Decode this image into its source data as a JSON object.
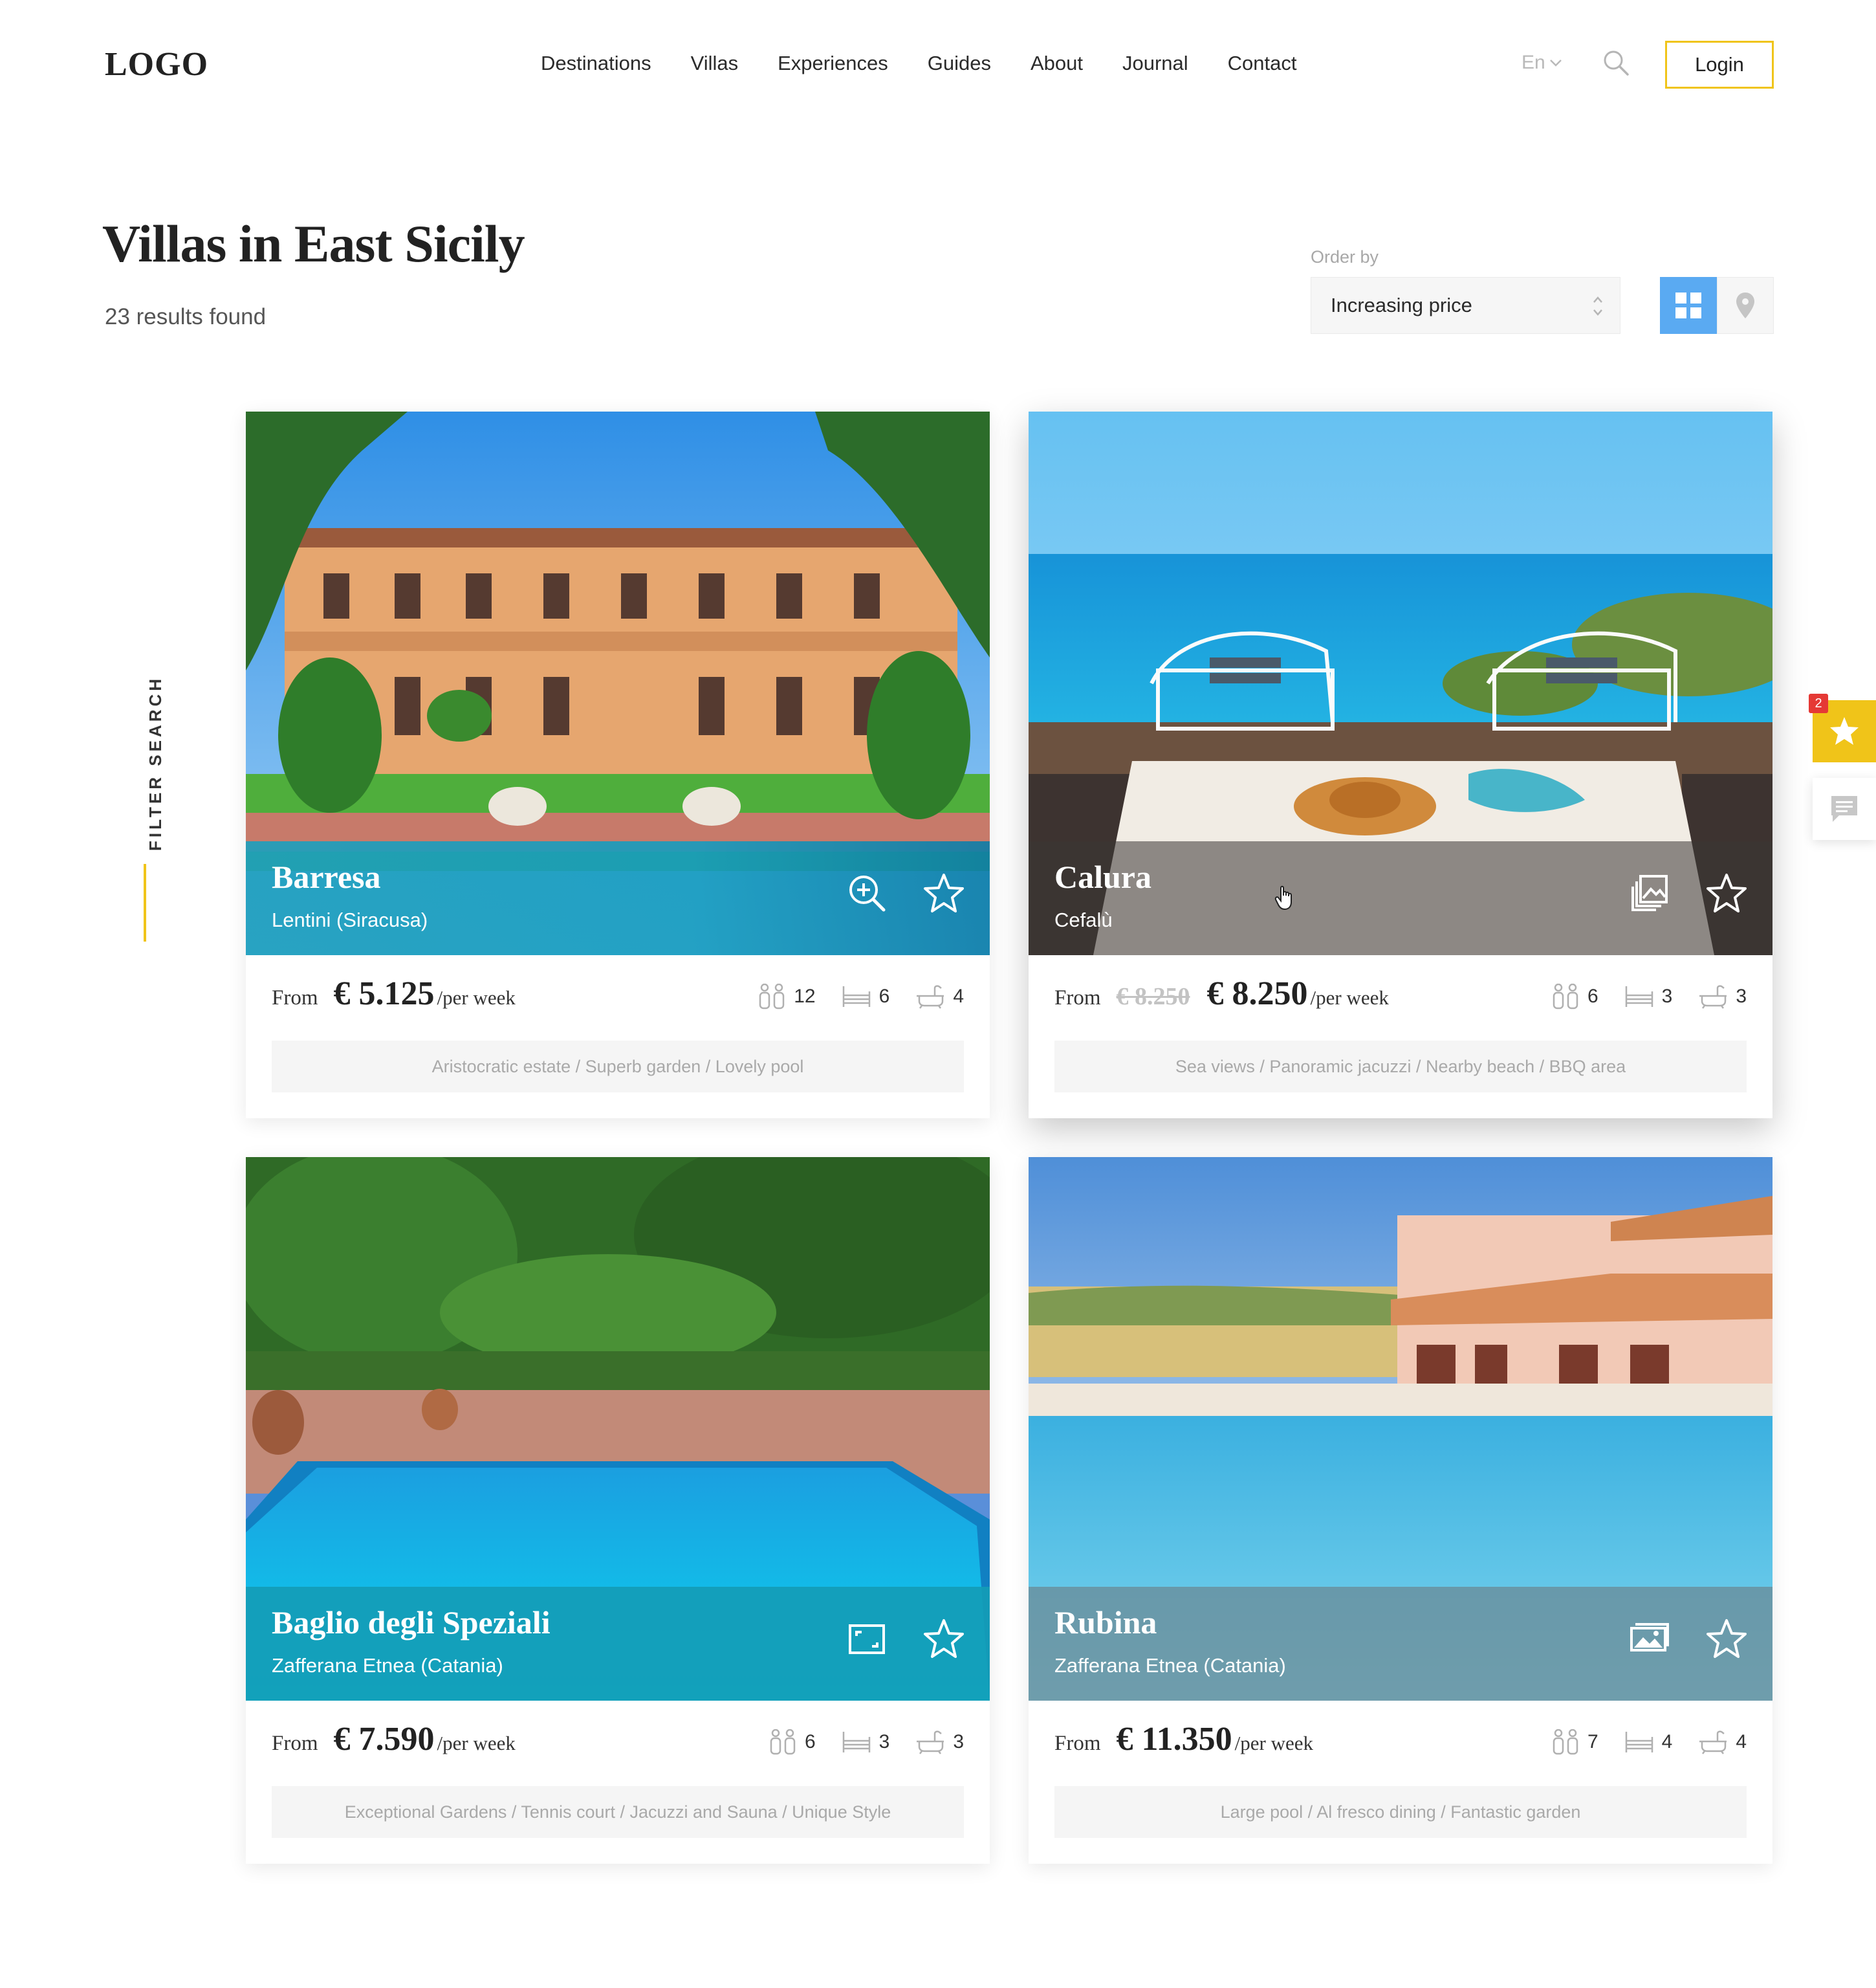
{
  "header": {
    "logo": "LOGO",
    "nav": [
      "Destinations",
      "Villas",
      "Experiences",
      "Guides",
      "About",
      "Journal",
      "Contact"
    ],
    "language": "En",
    "login_label": "Login"
  },
  "page": {
    "title": "Villas in East Sicily",
    "results": "23 results found",
    "order_label": "Order by",
    "order_value": "Increasing price",
    "filter_label": "FILTER SEARCH",
    "favorites_count": "2"
  },
  "villas": [
    {
      "name": "Barresa",
      "location": "Lentini (Siracusa)",
      "from_label": "From",
      "old_price": "",
      "price": "€ 5.125",
      "per": "/per week",
      "guests": "12",
      "bedrooms": "6",
      "bathrooms": "4",
      "tags": "Aristocratic estate / Superb garden / Lovely pool",
      "action_icon": "zoom-in-icon"
    },
    {
      "name": "Calura",
      "location": "Cefalù",
      "from_label": "From",
      "old_price": "€ 8.250",
      "price": "€ 8.250",
      "per": "/per week",
      "guests": "6",
      "bedrooms": "3",
      "bathrooms": "3",
      "tags": "Sea views / Panoramic jacuzzi / Nearby beach / BBQ area",
      "action_icon": "gallery-icon"
    },
    {
      "name": "Baglio degli Speziali",
      "location": "Zafferana Etnea (Catania)",
      "from_label": "From",
      "old_price": "",
      "price": "€ 7.590",
      "per": "/per week",
      "guests": "6",
      "bedrooms": "3",
      "bathrooms": "3",
      "tags": "Exceptional Gardens / Tennis court / Jacuzzi and Sauna / Unique Style",
      "action_icon": "fullscreen-icon"
    },
    {
      "name": "Rubina",
      "location": "Zafferana Etnea (Catania)",
      "from_label": "From",
      "old_price": "",
      "price": "€ 11.350",
      "per": "/per week",
      "guests": "7",
      "bedrooms": "4",
      "bathrooms": "4",
      "tags": "Large pool / Al fresco dining / Fantastic garden",
      "action_icon": "image-icon"
    }
  ],
  "colors": {
    "accent": "#f0c419",
    "view_active": "#5aaaf2",
    "badge": "#e53935"
  }
}
